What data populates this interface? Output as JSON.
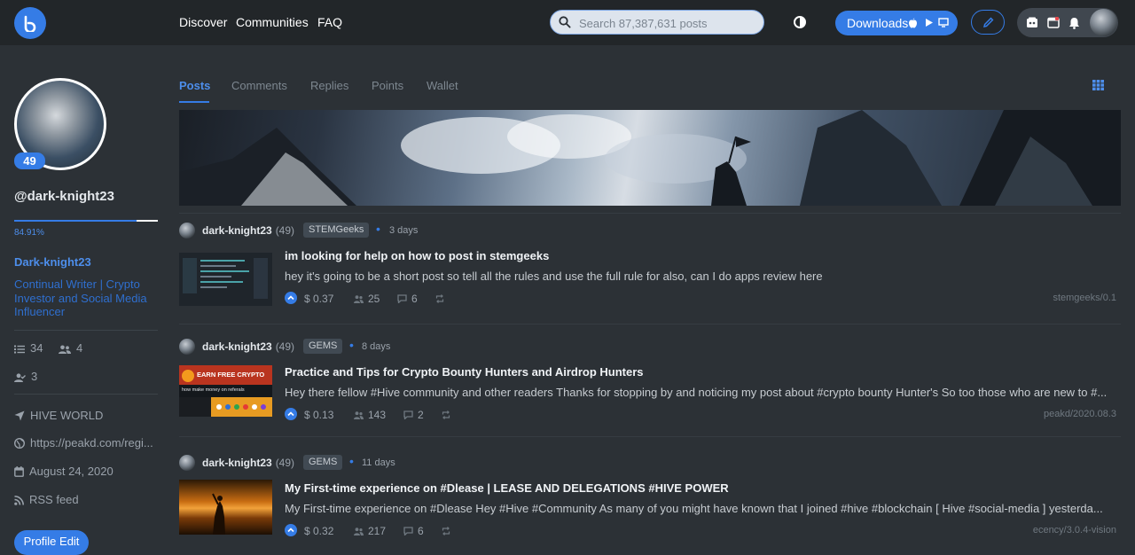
{
  "nav": {
    "links": [
      "Discover",
      "Communities",
      "FAQ"
    ],
    "search_placeholder": "Search 87,387,631 posts",
    "downloads_label": "Downloads"
  },
  "profile": {
    "reputation": "49",
    "username": "@dark-knight23",
    "voting_power_label": "84.91%",
    "voting_power": 0.8491,
    "display_name": "Dark-knight23",
    "about": "Continual Writer | Crypto Investor and Social Media Influencer",
    "following": "34",
    "followers": "4",
    "mutual": "3",
    "location": "HIVE WORLD",
    "website": "https://peakd.com/regi...",
    "joined": "August 24, 2020",
    "rss": "RSS feed",
    "edit_label": "Profile Edit"
  },
  "tabs": [
    "Posts",
    "Comments",
    "Replies",
    "Points",
    "Wallet"
  ],
  "posts": [
    {
      "author": "dark-knight23",
      "rep": "(49)",
      "community": "STEMGeeks",
      "ago": "3 days",
      "title": "im looking for help on how to post in stemgeeks",
      "summary": "hey it's going to be a short post so tell all the rules and use the full rule for also, can I do apps review here",
      "payout": "$ 0.37",
      "votes": "25",
      "comments": "6",
      "app": "stemgeeks/0.1"
    },
    {
      "author": "dark-knight23",
      "rep": "(49)",
      "community": "GEMS",
      "ago": "8 days",
      "title": "Practice and Tips for Crypto Bounty Hunters and Airdrop Hunters",
      "summary": "Hey there fellow #Hive community and other readers Thanks for stopping by and noticing my post about #crypto bounty Hunter's So too those who are new to #...",
      "payout": "$ 0.13",
      "votes": "143",
      "comments": "2",
      "app": "peakd/2020.08.3",
      "thumb_title": "EARN FREE CRYPTO",
      "thumb_sub": "how make money on referals"
    },
    {
      "author": "dark-knight23",
      "rep": "(49)",
      "community": "GEMS",
      "ago": "11 days",
      "title": "My First-time experience on #Dlease | LEASE AND DELEGATIONS #HIVE POWER",
      "summary": "My First-time experience on #Dlease Hey #Hive #Community As many of you might have known that I joined #hive #blockchain [ Hive #social-media ] yesterda...",
      "payout": "$ 0.32",
      "votes": "217",
      "comments": "6",
      "app": "ecency/3.0.4-vision"
    }
  ],
  "colors": {
    "accent": "#357ce6",
    "background": "#2c3136",
    "topbar": "#222629"
  }
}
